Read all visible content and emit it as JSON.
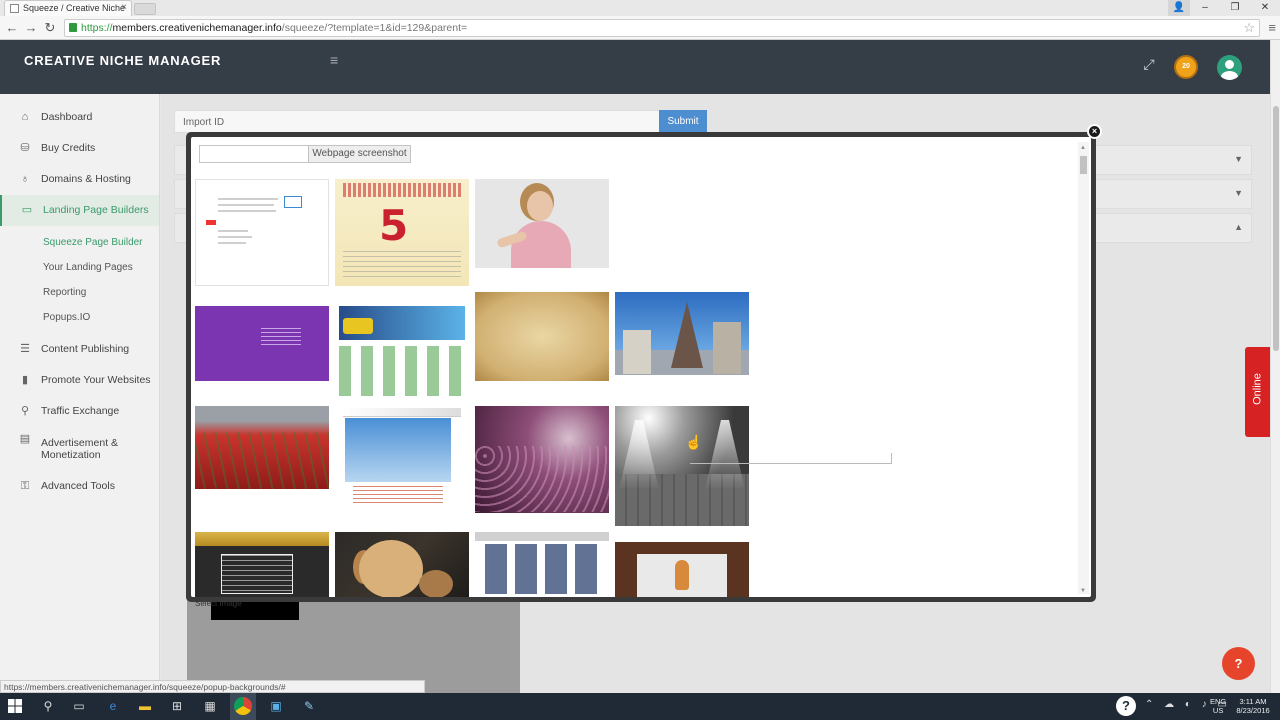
{
  "browser": {
    "tab_title": "Squeeze / Creative Niche",
    "url_scheme": "https://",
    "url_host": "members.creativenichemanager.info",
    "url_path": "/squeeze/?template=1&id=129&parent=",
    "status_url": "https://members.creativenichemanager.info/squeeze/popup-backgrounds/#"
  },
  "header": {
    "brand": "CREATIVE NICHE MANAGER",
    "credits_badge": "20"
  },
  "sidebar": {
    "items": [
      {
        "label": "Dashboard",
        "icon": "home-icon"
      },
      {
        "label": "Buy Credits",
        "icon": "coins-icon"
      },
      {
        "label": "Domains & Hosting",
        "icon": "lightbulb-icon"
      },
      {
        "label": "Landing Page Builders",
        "icon": "window-icon"
      }
    ],
    "subitems": [
      "Squeeze Page Builder",
      "Your Landing Pages",
      "Reporting",
      "Popups.IO"
    ],
    "items_after": [
      {
        "label": "Content Publishing",
        "icon": "list-icon"
      },
      {
        "label": "Promote Your Websites",
        "icon": "bar-chart-icon"
      },
      {
        "label": "Traffic Exchange",
        "icon": "map-pin-icon"
      },
      {
        "label": "Advertisement & Monetization",
        "icon": "document-icon"
      },
      {
        "label": "Advanced Tools",
        "icon": "gift-icon"
      }
    ]
  },
  "main": {
    "import_placeholder": "Import ID",
    "submit_label": "Submit",
    "select_image_label": "Select Image"
  },
  "modal": {
    "screenshot_button": "Webpage screenshot",
    "close_symbol": "×"
  },
  "widgets": {
    "online_label": "Online",
    "chat_symbol": "?"
  },
  "taskbar": {
    "lang_top": "ENG",
    "lang_bottom": "US",
    "time": "3:11 AM",
    "date": "8/23/2016"
  }
}
